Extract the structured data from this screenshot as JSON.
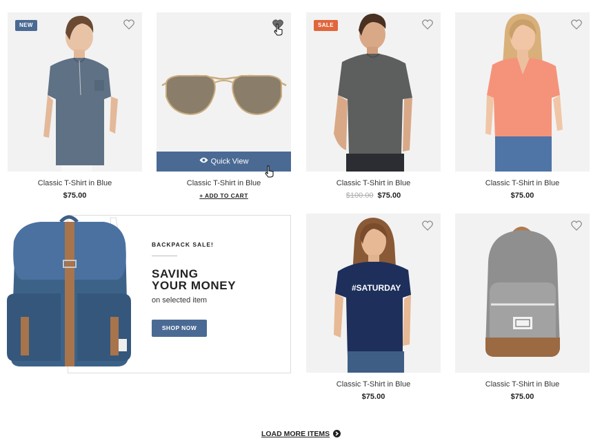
{
  "products": [
    {
      "title": "Classic T-Shirt in Blue",
      "price": "$75.00",
      "badge": "NEW",
      "badge_color": "#4a6a94"
    },
    {
      "title": "Classic T-Shirt in Blue",
      "add_to_cart": "+ ADD TO CART",
      "quick_view": "Quick View"
    },
    {
      "title": "Classic T-Shirt in Blue",
      "old_price": "$100.00",
      "price": "$75.00",
      "badge": "SALE",
      "badge_color": "#e0663c"
    },
    {
      "title": "Classic T-Shirt in Blue",
      "price": "$75.00"
    },
    {
      "title": "Classic T-Shirt in Blue",
      "price": "$75.00",
      "shirt_text": "#SATURDAY"
    },
    {
      "title": "Classic T-Shirt in Blue",
      "price": "$75.00"
    }
  ],
  "promo": {
    "kicker": "BACKPACK SALE!",
    "headline_line1": "SAVING",
    "headline_line2": "YOUR MONEY",
    "subtitle": "on selected item",
    "button": "SHOP NOW"
  },
  "load_more": "LOAD MORE ITEMS",
  "accent_color": "#4a6a94"
}
